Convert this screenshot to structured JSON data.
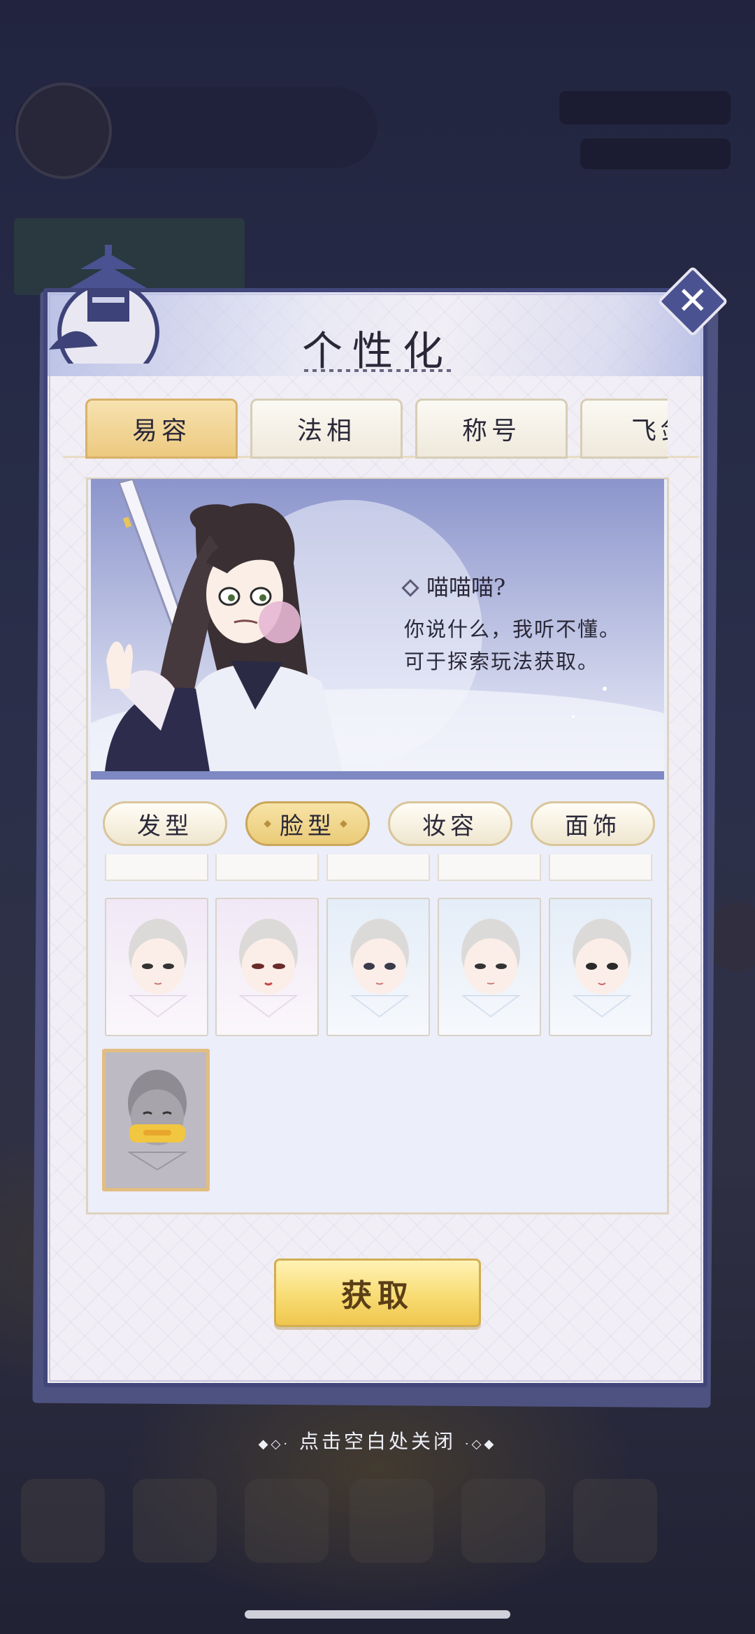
{
  "title": "个性化",
  "tabs": [
    {
      "label": "易容",
      "active": true
    },
    {
      "label": "法相",
      "active": false
    },
    {
      "label": "称号",
      "active": false
    },
    {
      "label": "飞剑",
      "active": false
    }
  ],
  "preview": {
    "name": "喵喵喵?",
    "desc_line1": "你说什么，我听不懂。",
    "desc_line2": "可于探索玩法获取。"
  },
  "subtabs": [
    {
      "label": "发型",
      "active": false
    },
    {
      "label": "脸型",
      "active": true
    },
    {
      "label": "妆容",
      "active": false
    },
    {
      "label": "面饰",
      "active": false
    }
  ],
  "faces": [
    {
      "id": "face-1",
      "tint": "pink"
    },
    {
      "id": "face-2",
      "tint": "pink"
    },
    {
      "id": "face-3",
      "tint": "blue"
    },
    {
      "id": "face-4",
      "tint": "blue"
    },
    {
      "id": "face-5",
      "tint": "blue"
    },
    {
      "id": "face-6",
      "tint": "selected"
    }
  ],
  "get_button": "获取",
  "close_hint": "点击空白处关闭",
  "colors": {
    "panel_border": "#41467a",
    "accent_gold": "#eacb78",
    "tab_active": "#ecc97f"
  }
}
